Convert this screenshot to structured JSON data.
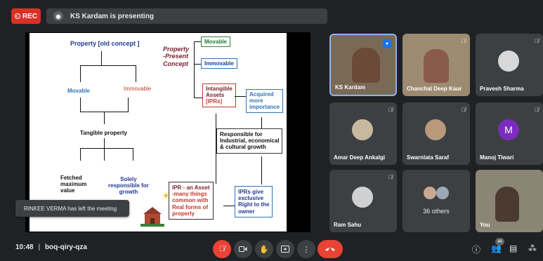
{
  "topbar": {
    "rec_label": "REC",
    "presenting_text": "KS Kardam is presenting"
  },
  "slide": {
    "old_concept_title": "Property [old concept ]",
    "movable_left": "Movable",
    "immovable_left": "Immovable",
    "tangible_property": "Tangible property",
    "fetched_line1": "Fetched",
    "fetched_line2": "maximum",
    "fetched_line3": "value",
    "solely_line1": "Solely",
    "solely_line2": "responsible for",
    "solely_line3": "growth",
    "present_line1": "Property",
    "present_line2": "-Present",
    "present_line3": "Concept",
    "movable_box": "Movable",
    "immovable_box": "Immovable",
    "intangible_line1": "Intangible",
    "intangible_line2": "Assets",
    "intangible_line3": "[IPRs]",
    "acquired_line1": "Acquired",
    "acquired_line2": "more",
    "acquired_line3": "importance",
    "responsible_line1": "Responsible for",
    "responsible_line2": "Industrial, economical",
    "responsible_line3": "& cultural growth",
    "ipr_asset_line1": "IPR  - an Asset",
    "ipr_asset_line2": "-many things",
    "ipr_asset_line3": "common with",
    "ipr_asset_line4": "Real forms of",
    "ipr_asset_line5": "properly",
    "iprs_give_line1": "IPRs give",
    "iprs_give_line2": "exclusive",
    "iprs_give_line3": "Right to the",
    "iprs_give_line4": "owner"
  },
  "participants": [
    {
      "name": "KS Kardam",
      "muted": false
    },
    {
      "name": "Chanchal Deep Kaur",
      "muted": true
    },
    {
      "name": "Pravesh Sharma",
      "muted": true
    },
    {
      "name": "Amar Deep Ankalgi",
      "muted": true
    },
    {
      "name": "Swarnlata Saraf",
      "muted": true
    },
    {
      "name": "Manoj Tiwari",
      "muted": true,
      "initial": "M"
    },
    {
      "name": "Ram Sahu",
      "muted": true
    },
    {
      "name": "36 others"
    },
    {
      "name": "You"
    }
  ],
  "toast": "RINKEE VERMA has left the meeting",
  "bottombar": {
    "time": "10:48",
    "separator": "|",
    "meeting_code": "boq-qiry-qza",
    "participant_count": "46"
  },
  "icons": {
    "mic_off": "mic-off-icon",
    "camera": "camera-icon",
    "raise_hand": "hand-icon",
    "present": "present-icon",
    "more": "more-icon",
    "hangup": "hangup-icon",
    "info": "info-icon",
    "people": "people-icon",
    "chat": "chat-icon",
    "activities": "activities-icon"
  },
  "colors": {
    "rec": "#d93025",
    "hangup": "#ea4335",
    "speaking": "#1a73e8",
    "background": "#202124"
  }
}
